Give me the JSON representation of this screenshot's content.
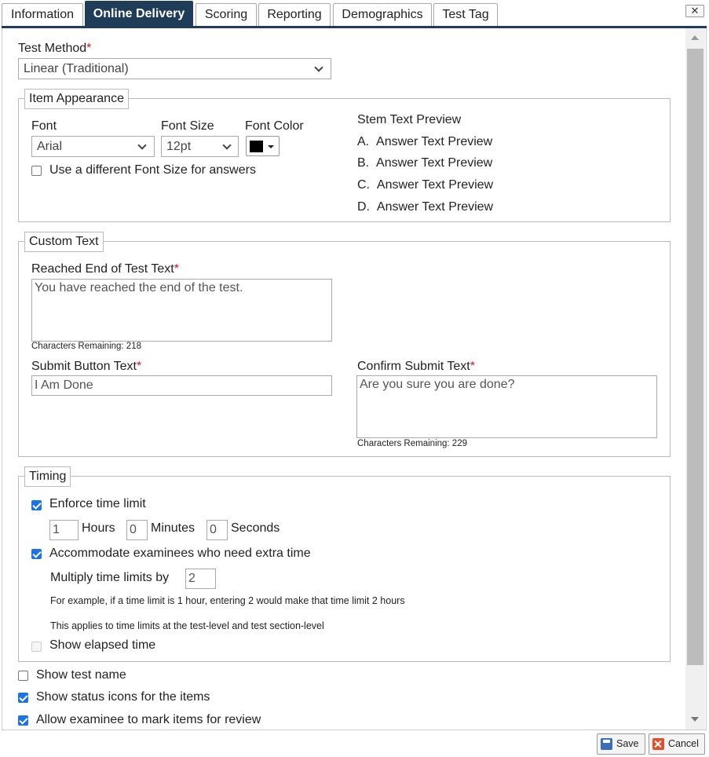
{
  "tabs": [
    {
      "label": "Information",
      "active": false
    },
    {
      "label": "Online Delivery",
      "active": true
    },
    {
      "label": "Scoring",
      "active": false
    },
    {
      "label": "Reporting",
      "active": false
    },
    {
      "label": "Demographics",
      "active": false
    },
    {
      "label": "Test Tag",
      "active": false
    }
  ],
  "close_label": "✕",
  "test_method": {
    "label": "Test Method",
    "required_mark": "*",
    "value": "Linear (Traditional)"
  },
  "item_appearance": {
    "legend": "Item Appearance",
    "font_label": "Font",
    "font_value": "Arial",
    "font_size_label": "Font Size",
    "font_size_value": "12pt",
    "font_color_label": "Font Color",
    "font_color_value": "#000000",
    "different_size_label": "Use a different Font Size for answers",
    "different_size_checked": false,
    "preview": {
      "stem": "Stem Text Preview",
      "answers": [
        {
          "letter": "A.",
          "text": "Answer Text Preview"
        },
        {
          "letter": "B.",
          "text": "Answer Text Preview"
        },
        {
          "letter": "C.",
          "text": "Answer Text Preview"
        },
        {
          "letter": "D.",
          "text": "Answer Text Preview"
        }
      ]
    }
  },
  "custom_text": {
    "legend": "Custom Text",
    "end_label": "Reached End of Test Text",
    "end_value": "You have reached the end of the test.",
    "end_remaining": "Characters Remaining: 218",
    "submit_label": "Submit Button Text",
    "submit_value": "I Am Done",
    "confirm_label": "Confirm Submit Text",
    "confirm_value": "Are you sure you are done?",
    "confirm_remaining": "Characters Remaining: 229",
    "required_mark": "*"
  },
  "timing": {
    "legend": "Timing",
    "enforce_label": "Enforce time limit",
    "enforce_checked": true,
    "hours_value": "1",
    "hours_label": "Hours",
    "minutes_value": "0",
    "minutes_label": "Minutes",
    "seconds_value": "0",
    "seconds_label": "Seconds",
    "accommodate_label": "Accommodate examinees who need extra time",
    "accommodate_checked": true,
    "multiply_label": "Multiply time limits by",
    "multiply_value": "2",
    "example_note": "For example, if a time limit is 1 hour, entering 2 would make that time limit 2 hours",
    "applies_note": "This applies to time limits at the test-level and test section-level",
    "elapsed_label": "Show elapsed time",
    "elapsed_checked": false
  },
  "options": [
    {
      "label": "Show test name",
      "checked": false
    },
    {
      "label": "Show status icons for the items",
      "checked": true
    },
    {
      "label": "Allow examinee to mark items for review",
      "checked": true
    }
  ],
  "footer": {
    "save_label": "Save",
    "cancel_label": "Cancel"
  }
}
